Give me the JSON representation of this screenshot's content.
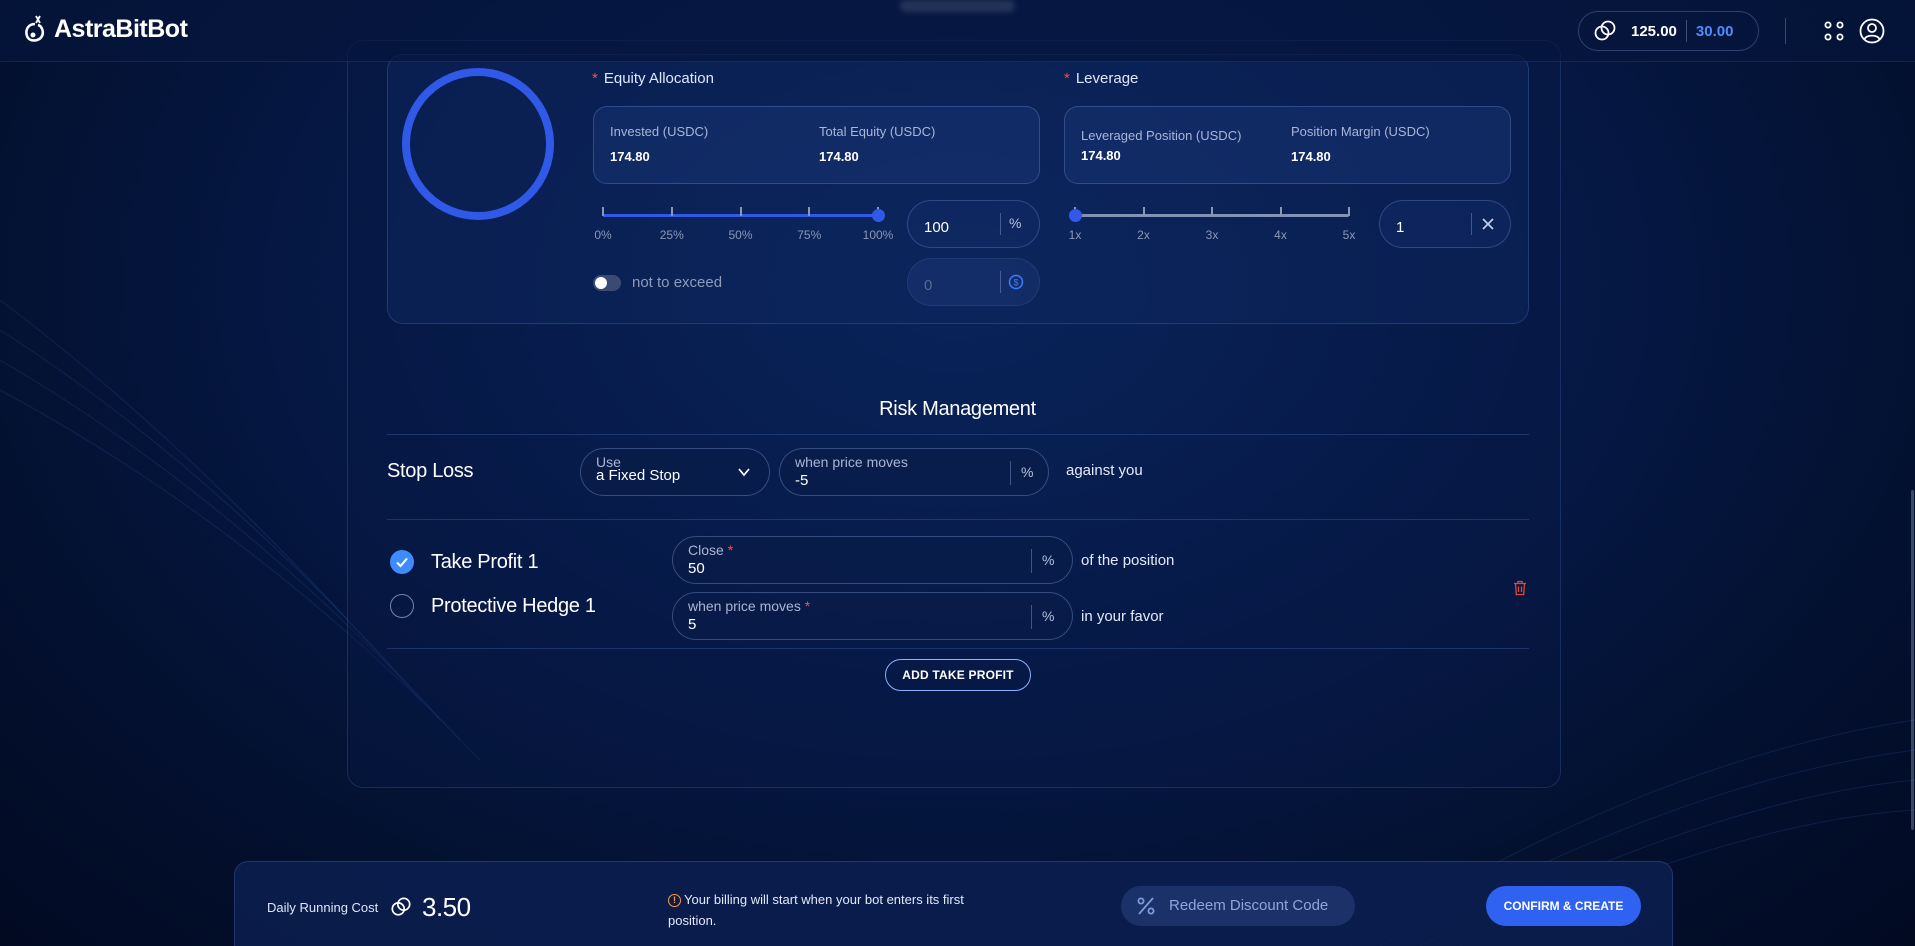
{
  "header": {
    "logo_text": "AstraBitBot",
    "balance_primary": "125.00",
    "balance_secondary": "30.00",
    "icons": [
      "coin-icon",
      "apps-grid-icon",
      "user-account-icon"
    ]
  },
  "equity": {
    "label": "Equity Allocation",
    "invested_label": "Invested (USDC)",
    "invested_value": "174.80",
    "total_label": "Total Equity (USDC)",
    "total_value": "174.80",
    "slider_ticks": [
      "0%",
      "25%",
      "50%",
      "75%",
      "100%"
    ],
    "slider_value": 1.0,
    "percent_value": "100",
    "percent_unit": "%",
    "toggle_label": "not to exceed",
    "toggle_on": false,
    "cap_value": "0"
  },
  "leverage": {
    "label": "Leverage",
    "position_label": "Leveraged Position (USDC)",
    "position_value": "174.80",
    "margin_label": "Position Margin (USDC)",
    "margin_value": "174.80",
    "slider_ticks": [
      "1x",
      "2x",
      "3x",
      "4x",
      "5x"
    ],
    "slider_value": 0.0,
    "value": "1"
  },
  "risk": {
    "title": "Risk Management",
    "stop_loss": {
      "label": "Stop Loss",
      "type_label": "Use",
      "type_value": "a Fixed Stop",
      "move_label": "when price moves",
      "move_value": "-5",
      "unit": "%",
      "suffix": "against you"
    },
    "take_profit": {
      "label": "Take Profit 1",
      "checked": true,
      "close_label": "Close",
      "close_value": "50",
      "unit": "%",
      "suffix": "of the position"
    },
    "hedge": {
      "label": "Protective Hedge 1",
      "checked": false,
      "move_label": "when price moves",
      "move_value": "5",
      "unit": "%",
      "suffix": "in your favor"
    },
    "add_button": "ADD TAKE PROFIT"
  },
  "footer": {
    "cost_label": "Daily Running Cost",
    "cost_value": "3.50",
    "billing_note": "Your billing will start when your bot enters its first position.",
    "redeem_label": "Redeem Discount Code",
    "confirm_label": "CONFIRM & CREATE"
  },
  "colors": {
    "accent": "#3159e8",
    "button": "#2f62f0",
    "check": "#3d8bff",
    "required": "#ff4b4b",
    "balance_secondary": "#4d8dff",
    "warning": "#ff9a3c"
  }
}
